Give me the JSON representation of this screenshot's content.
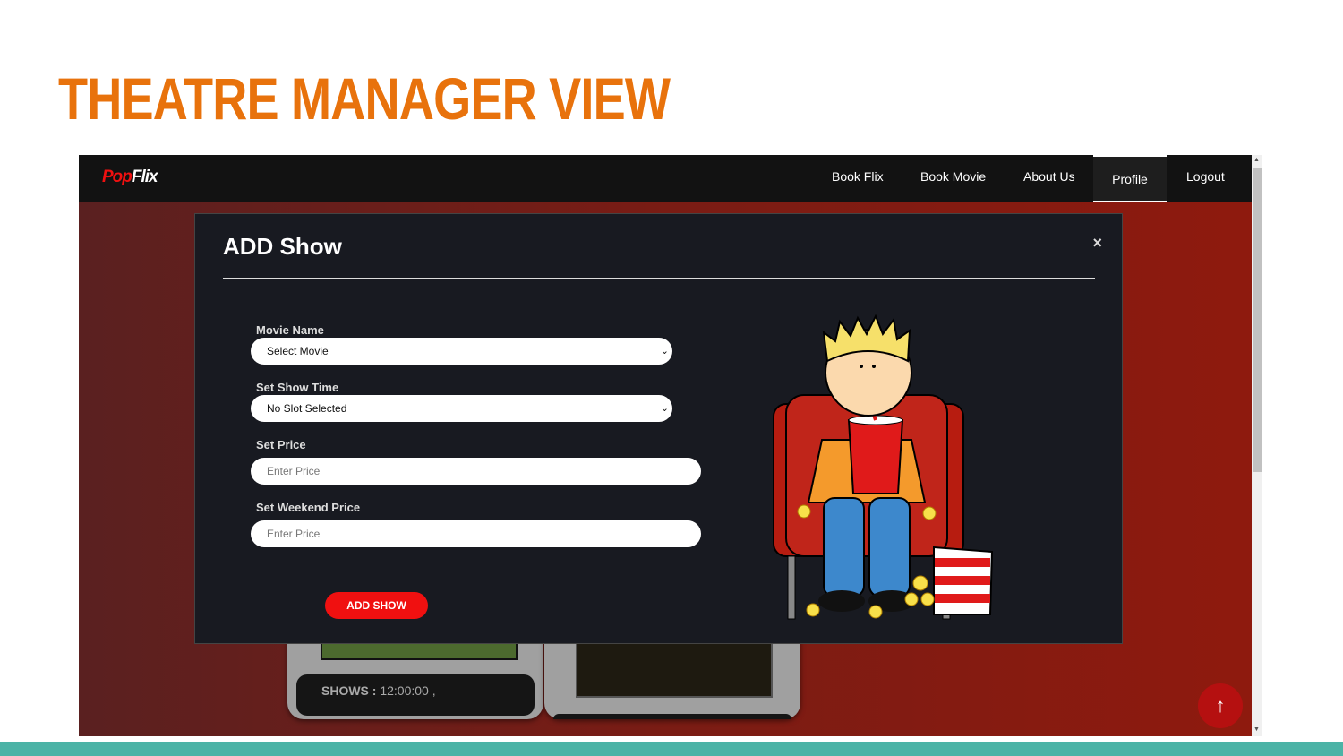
{
  "slide": {
    "title": "THEATRE MANAGER VIEW"
  },
  "nav": {
    "logo_part1": "Pop",
    "logo_part2": "Flix",
    "items": [
      "Book Flix",
      "Book Movie",
      "About Us",
      "Profile",
      "Logout"
    ],
    "active": "Profile"
  },
  "background": {
    "shows_label": "SHOWS :",
    "shows_value": "12:00:00 ,"
  },
  "modal": {
    "title": "ADD Show",
    "close": "×",
    "fields": [
      {
        "label": "Movie Name",
        "value": "Select Movie",
        "type": "select"
      },
      {
        "label": "Set Show Time",
        "value": "No Slot Selected",
        "type": "select"
      },
      {
        "label": "Set Price",
        "placeholder": "Enter Price",
        "type": "input"
      },
      {
        "label": "Set Weekend Price",
        "placeholder": "Enter Price",
        "type": "input"
      }
    ],
    "submit": "ADD SHOW"
  },
  "scroll_top": "↑",
  "colors": {
    "title": "#e8720c",
    "accent": "#f01010",
    "modal_bg": "#181a21",
    "teal": "#4bb3a6"
  }
}
